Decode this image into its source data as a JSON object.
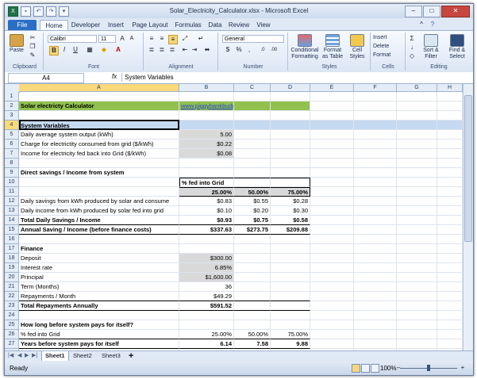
{
  "window": {
    "title": "Solar_Electricity_Calculator.xlsx - Microsoft Excel"
  },
  "ribbon_tabs": [
    "File",
    "Home",
    "Developer",
    "Insert",
    "Page Layout",
    "Formulas",
    "Data",
    "Review",
    "View"
  ],
  "ribbon": {
    "paste": "Paste",
    "font_name": "Calibri",
    "font_size": "11",
    "number_format": "General",
    "conditional_formatting": "Conditional Formatting",
    "format_as_table": "Format as Table",
    "cell_styles": "Cell Styles",
    "insert": "Insert",
    "delete": "Delete",
    "format": "Format",
    "sort_filter": "Sort & Filter",
    "find_select": "Find & Select",
    "groups": {
      "clipboard": "Clipboard",
      "font": "Font",
      "alignment": "Alignment",
      "number": "Number",
      "styles": "Styles",
      "cells": "Cells",
      "editing": "Editing"
    }
  },
  "formula_bar": {
    "name_box": "A4",
    "fx": "fx",
    "content": "System Variables"
  },
  "columns": [
    "A",
    "B",
    "C",
    "D",
    "E",
    "F",
    "G",
    "H"
  ],
  "rows": [
    {
      "n": "1",
      "cells": [
        "",
        "",
        "",
        ""
      ]
    },
    {
      "n": "2",
      "cells": [
        "Solar electricty Calculator",
        "www.piggybankbudget.com",
        "",
        ""
      ]
    },
    {
      "n": "3",
      "cells": [
        "",
        "",
        "",
        ""
      ]
    },
    {
      "n": "4",
      "cells": [
        "System Variables",
        "",
        "",
        ""
      ]
    },
    {
      "n": "5",
      "cells": [
        "Daily average system output (kWh)",
        "5.00",
        "",
        ""
      ]
    },
    {
      "n": "6",
      "cells": [
        "Charge for electrictity consumed from grid ($/kWh)",
        "$0.22",
        "",
        ""
      ]
    },
    {
      "n": "7",
      "cells": [
        "Income for electricity fed back into Grid ($/kWh)",
        "$0.08",
        "",
        ""
      ]
    },
    {
      "n": "8",
      "cells": [
        "",
        "",
        "",
        ""
      ]
    },
    {
      "n": "9",
      "cells": [
        "Direct savings / Income from system",
        "",
        "",
        ""
      ]
    },
    {
      "n": "10",
      "cells": [
        "",
        "% fed into Grid",
        "",
        ""
      ]
    },
    {
      "n": "11",
      "cells": [
        "",
        "25.00%",
        "50.00%",
        "75.00%"
      ]
    },
    {
      "n": "12",
      "cells": [
        "Daily savings from kWh produced by solar and consume",
        "$0.83",
        "$0.55",
        "$0.28"
      ]
    },
    {
      "n": "13",
      "cells": [
        "Daily income from kWh produced by solar fed into grid",
        "$0.10",
        "$0.20",
        "$0.30"
      ]
    },
    {
      "n": "14",
      "cells": [
        "Total Daily Savings / Income",
        "$0.93",
        "$0.75",
        "$0.58"
      ]
    },
    {
      "n": "15",
      "cells": [
        "Annual Saving / Income (before finance costs)",
        "$337.63",
        "$273.75",
        "$209.88"
      ]
    },
    {
      "n": "16",
      "cells": [
        "",
        "",
        "",
        ""
      ]
    },
    {
      "n": "17",
      "cells": [
        "Finance",
        "",
        "",
        ""
      ]
    },
    {
      "n": "18",
      "cells": [
        "Deposit",
        "$300.00",
        "",
        ""
      ]
    },
    {
      "n": "19",
      "cells": [
        "Interest rate",
        "6.85%",
        "",
        ""
      ]
    },
    {
      "n": "20",
      "cells": [
        "Principal",
        "$1,600.00",
        "",
        ""
      ]
    },
    {
      "n": "21",
      "cells": [
        "Term (Months)",
        "36",
        "",
        ""
      ]
    },
    {
      "n": "22",
      "cells": [
        "Repayments / Month",
        "$49.29",
        "",
        ""
      ]
    },
    {
      "n": "23",
      "cells": [
        "Total Repayments Annually",
        "$591.52",
        "",
        ""
      ]
    },
    {
      "n": "24",
      "cells": [
        "",
        "",
        "",
        ""
      ]
    },
    {
      "n": "25",
      "cells": [
        "How long before system pays for itself?",
        "",
        "",
        ""
      ]
    },
    {
      "n": "26",
      "cells": [
        "% fed into Grid",
        "25.00%",
        "50.00%",
        "75.00%"
      ]
    },
    {
      "n": "27",
      "cells": [
        "Years before system pays for itself",
        "6.14",
        "7.58",
        "9.88"
      ]
    },
    {
      "n": "28",
      "cells": [
        "",
        "",
        "",
        ""
      ]
    }
  ],
  "sheet_tabs": [
    "Sheet1",
    "Sheet2",
    "Sheet3"
  ],
  "status": {
    "ready": "Ready",
    "zoom": "100%"
  }
}
